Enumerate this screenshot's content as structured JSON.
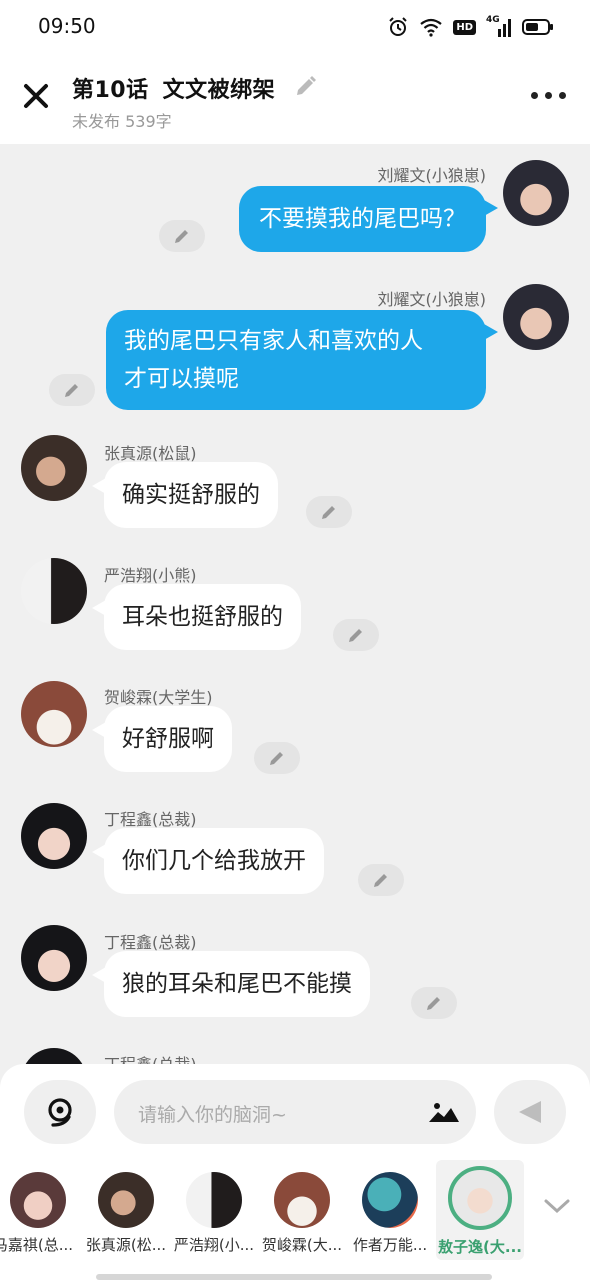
{
  "status": {
    "time": "09:50",
    "network": "4G",
    "hd": "HD"
  },
  "header": {
    "episode": "第10话",
    "title": "文文被绑架",
    "subtitle": "未发布 539字"
  },
  "messages": [
    {
      "side": "right",
      "name": "刘耀文(小狼崽)",
      "text": "不要摸我的尾巴吗？"
    },
    {
      "side": "right",
      "name": "刘耀文(小狼崽)",
      "line1": "我的尾巴只有家人和喜欢的人",
      "line2": "才可以摸呢"
    },
    {
      "side": "left",
      "name": "张真源(松鼠)",
      "text": "确实挺舒服的"
    },
    {
      "side": "left",
      "name": "严浩翔(小熊)",
      "text": "耳朵也挺舒服的"
    },
    {
      "side": "left",
      "name": "贺峻霖(大学生)",
      "text": "好舒服啊"
    },
    {
      "side": "left",
      "name": "丁程鑫(总裁)",
      "text": "你们几个给我放开"
    },
    {
      "side": "left",
      "name": "丁程鑫(总裁)",
      "text": "狼的耳朵和尾巴不能摸"
    },
    {
      "side": "left",
      "name": "丁程鑫(总裁)",
      "text": ""
    }
  ],
  "composer": {
    "placeholder": "请输入你的脑洞~"
  },
  "characters": [
    {
      "label": "马嘉祺(总...",
      "active": false
    },
    {
      "label": "张真源(松...",
      "active": false
    },
    {
      "label": "严浩翔(小...",
      "active": false
    },
    {
      "label": "贺峻霖(大...",
      "active": false
    },
    {
      "label": "作者万能...",
      "active": false
    },
    {
      "label": "敖子逸(大...",
      "active": true
    }
  ],
  "colors": {
    "right_bubble": "#1ea7e9",
    "active_char": "#4caf82"
  }
}
